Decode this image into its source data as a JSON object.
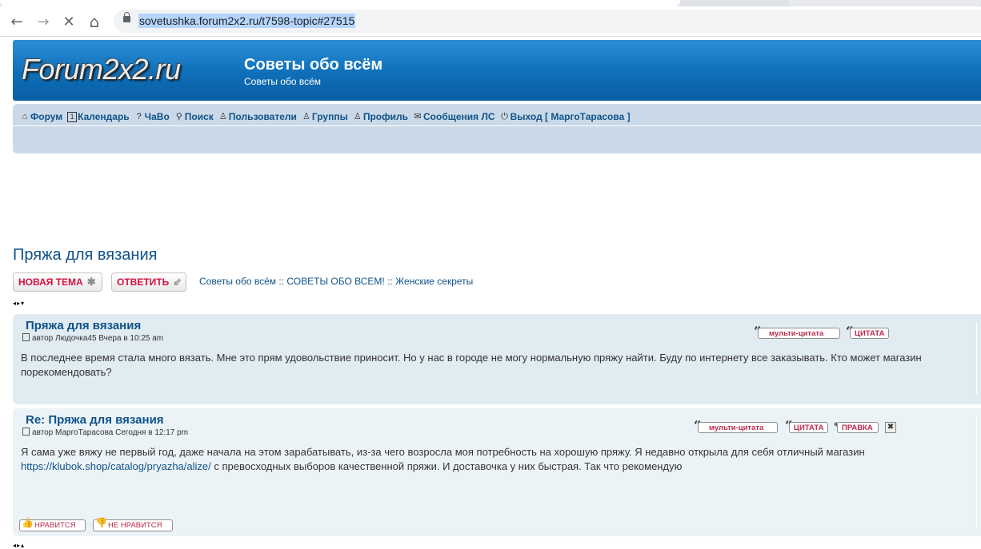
{
  "browser": {
    "url": "sovetushka.forum2x2.ru/t7598-topic#27515",
    "back_icon": "←",
    "forward_icon": "→",
    "stop_icon": "✕",
    "home_icon": "⌂"
  },
  "header": {
    "logo": "Forum2x2.ru",
    "title": "Советы обо всём",
    "subtitle": "Советы обо всём"
  },
  "nav": {
    "items": [
      {
        "icon": "⌂",
        "label": "Форум"
      },
      {
        "icon": "1",
        "label": "Календарь"
      },
      {
        "icon": "?",
        "label": "ЧаВо"
      },
      {
        "icon": "⚲",
        "label": "Поиск"
      },
      {
        "icon": "♙",
        "label": "Пользователи"
      },
      {
        "icon": "♙",
        "label": "Группы"
      },
      {
        "icon": "♙",
        "label": "Профиль"
      },
      {
        "icon": "✉",
        "label": "Сообщения ЛС"
      },
      {
        "icon": "⏻",
        "label": "Выход [ МаргоТарасова ]"
      }
    ]
  },
  "topic": {
    "title": "Пряжа для вязания",
    "new_topic_label": "НОВАЯ ТЕМА",
    "reply_label": "ОТВЕТИТЬ",
    "breadcrumbs": "Советы обо всём :: СОВЕТЫ ОБО ВСЕМ! :: Женские секреты"
  },
  "posts": [
    {
      "title": "Пряжа для вязания",
      "meta": "автор Людочка45 Вчера в 10:25 am",
      "body": "В последнее время стала много вязать. Мне это прям удовольствие приносит. Но у нас в городе не могу нормальную пряжу найти. Буду по интернету все заказывать. Кто может магазин порекомендовать?",
      "multiquote": "мульти-цитата",
      "quote": "ЦИТАТА"
    },
    {
      "title": "Re: Пряжа для вязания",
      "meta": "автор МаргоТарасова Сегодня в 12:17 pm",
      "body_before": "Я сама уже вяжу не первый год, даже начала на этом зарабатывать, из-за чего возросла моя потребность на хорошую пряжу. Я недавно открыла для себя отличный магазин ",
      "link": "https://klubok.shop/catalog/pryazha/alize/",
      "body_after": " с превосходных выборов качественной пряжи. И доставочка у них быстрая. Так что рекомендую",
      "multiquote": "мульти-цитата",
      "quote": "ЦИТАТА",
      "edit": "ПРАВКА",
      "delete_icon": "✖",
      "like": "НРАВИТСЯ",
      "dislike": "НЕ НРАВИТСЯ"
    }
  ]
}
